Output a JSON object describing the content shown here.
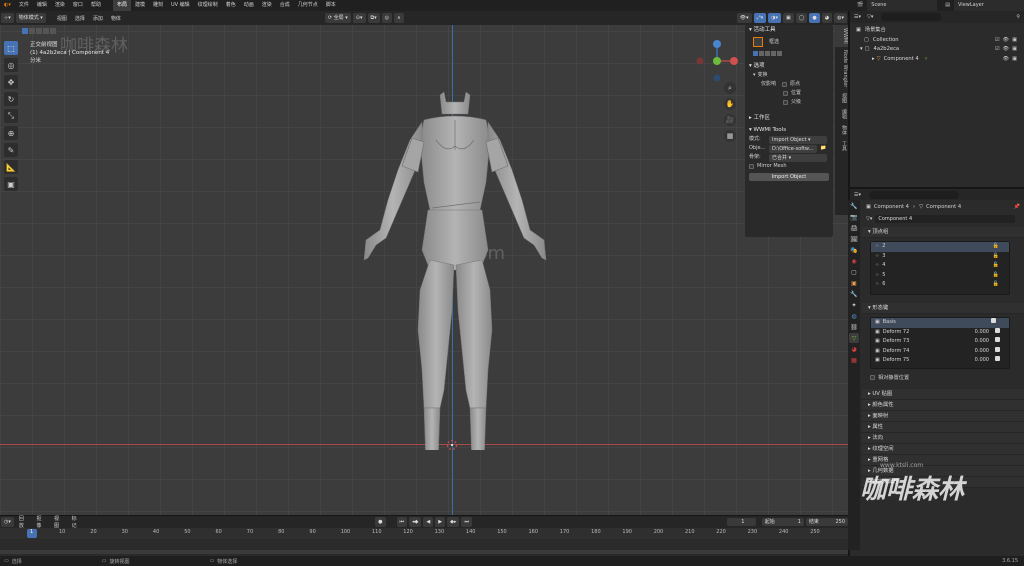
{
  "menu": {
    "items": [
      "文件",
      "编辑",
      "渲染",
      "窗口",
      "帮助"
    ],
    "workspaces": [
      "布局",
      "建模",
      "雕刻",
      "UV 编辑",
      "纹理绘制",
      "着色",
      "动画",
      "渲染",
      "合成",
      "几何节点",
      "脚本"
    ],
    "scene_label": "Scene",
    "viewlayer_label": "ViewLayer"
  },
  "viewport_header": {
    "mode": "物体模式",
    "menus": [
      "视图",
      "选择",
      "添加",
      "物体"
    ],
    "transform": "全局",
    "options": "选项"
  },
  "viewport": {
    "view_name": "正交前视图",
    "object_info": "(1) 4a2b2eca | Component 4",
    "units": "分米",
    "watermark_top": "咖啡森林",
    "watermark_mid": "ktsli.com"
  },
  "npanel": {
    "active_tool_title": "活动工具",
    "tool_name": "框选",
    "options_title": "选项",
    "transform_title": "变换",
    "affect_only_label": "仅影响",
    "affect_items": [
      "原点",
      "位置",
      "父级"
    ],
    "workspace_title": "工作区",
    "wwmi_title": "WWMI Tools",
    "mode_label": "模式:",
    "mode_value": "Import Object",
    "object_label": "Obje...",
    "object_value": "D:\\Office-softw...",
    "merge_label": "骨架:",
    "merge_value": "已合并",
    "mirror_mesh": "Mirror Mesh",
    "import_button": "Import Object"
  },
  "vertical_tabs": [
    "WWMI",
    "Node Wrangler",
    "视图",
    "编辑",
    "物体",
    "工具"
  ],
  "outliner": {
    "search_placeholder": "",
    "rows": [
      {
        "label": "场景集合",
        "indent": 0
      },
      {
        "label": "Collection",
        "indent": 1
      },
      {
        "label": "4a2b2eca",
        "indent": 1
      },
      {
        "label": "Component 4",
        "indent": 2
      }
    ]
  },
  "properties": {
    "breadcrumb_obj": "Component 4",
    "breadcrumb_mesh": "Component 4",
    "mesh_name": "Component 4",
    "vertex_groups_title": "顶点组",
    "vertex_groups": [
      "2",
      "3",
      "4",
      "5",
      "6"
    ],
    "shape_keys_title": "形态键",
    "shape_keys": [
      {
        "name": "Basis",
        "value": ""
      },
      {
        "name": "Deform 72",
        "value": "0.000"
      },
      {
        "name": "Deform 73",
        "value": "0.000"
      },
      {
        "name": "Deform 74",
        "value": "0.000"
      },
      {
        "name": "Deform 75",
        "value": "0.000"
      }
    ],
    "relative_label": "相对静置位置",
    "sections": [
      "UV 贴图",
      "颜色属性",
      "面映射",
      "属性",
      "法向",
      "纹理空间",
      "重网格",
      "几何数据",
      "自定义属性"
    ]
  },
  "timeline": {
    "menus": [
      "回放",
      "抠像",
      "视图",
      "标记"
    ],
    "current_frame": "1",
    "start_label": "起始",
    "start": "1",
    "end_label": "结束",
    "end": "250",
    "ticks": [
      "1",
      "10",
      "20",
      "30",
      "40",
      "50",
      "60",
      "70",
      "80",
      "90",
      "100",
      "110",
      "120",
      "130",
      "140",
      "150",
      "160",
      "170",
      "180",
      "190",
      "200",
      "210",
      "220",
      "230",
      "240",
      "250"
    ]
  },
  "status": {
    "left": "选择",
    "mid": "旋转视图",
    "right": "物体选择",
    "version": "3.6.15"
  },
  "watermark_bottom": {
    "brand": "咖啡森林",
    "url": "www.ktsli.com"
  },
  "colors": {
    "accent": "#4772b3",
    "grid_line": "#444444",
    "viewport_bg": "#3c3c3c",
    "x_axis": "#a84a4a",
    "z_axis": "#3a6fb0"
  }
}
